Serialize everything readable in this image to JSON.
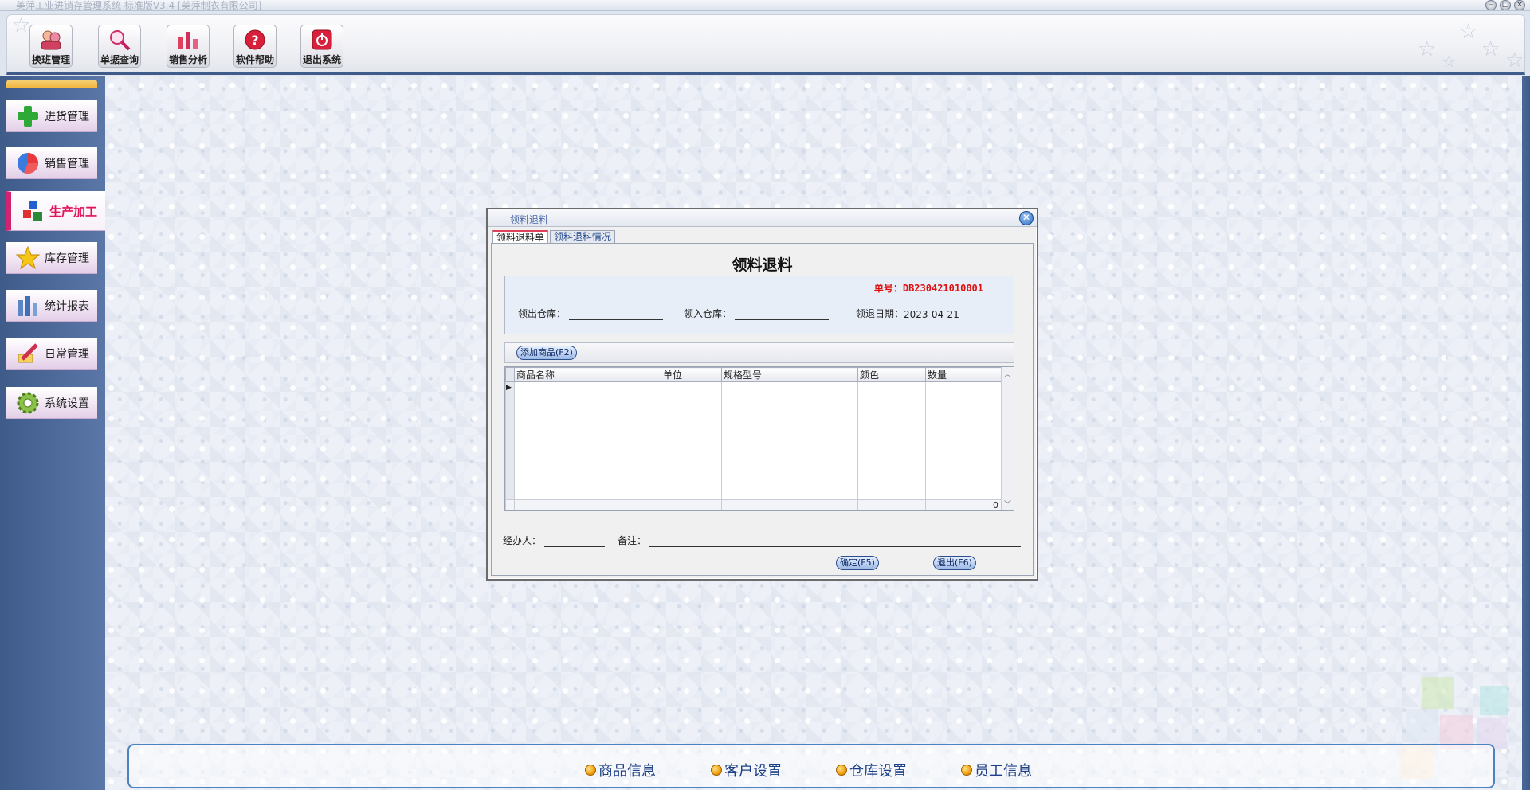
{
  "window": {
    "title": "美萍工业进销存管理系统 标准版V3.4 [美萍制衣有限公司]",
    "controls": [
      "minimize",
      "maximize",
      "close"
    ]
  },
  "toolbar": {
    "buttons": [
      {
        "label": "换班管理",
        "icon": "shift-icon"
      },
      {
        "label": "单据查询",
        "icon": "magnifier-icon"
      },
      {
        "label": "销售分析",
        "icon": "bar-chart-icon"
      },
      {
        "label": "软件帮助",
        "icon": "help-icon"
      },
      {
        "label": "退出系统",
        "icon": "power-icon"
      }
    ]
  },
  "sidebar": {
    "items": [
      {
        "label": "进货管理",
        "icon": "plus-icon",
        "active": false
      },
      {
        "label": "销售管理",
        "icon": "pie-icon",
        "active": false
      },
      {
        "label": "生产加工",
        "icon": "cubes-icon",
        "active": true
      },
      {
        "label": "库存管理",
        "icon": "star-icon",
        "active": false
      },
      {
        "label": "统计报表",
        "icon": "report-icon",
        "active": false
      },
      {
        "label": "日常管理",
        "icon": "pencil-icon",
        "active": false
      },
      {
        "label": "系统设置",
        "icon": "gear-icon",
        "active": false
      }
    ]
  },
  "quickbar": {
    "items": [
      "商品信息",
      "客户设置",
      "仓库设置",
      "员工信息"
    ]
  },
  "dialog": {
    "title": "领料退料",
    "close_symbol": "✕",
    "tabs": [
      "领料退料单",
      "领料退料情况"
    ],
    "form_title": "领料退料",
    "order_no": "单号：DB230421010001",
    "out_warehouse_label": "领出仓库：",
    "out_warehouse_value": "",
    "in_warehouse_label": "领入仓库：",
    "in_warehouse_value": "",
    "date_label": "领退日期：",
    "date_value": "2023-04-21",
    "add_button": "添加商品(F2)",
    "grid": {
      "columns": [
        "商品名称",
        "单位",
        "规格型号",
        "颜色",
        "数量"
      ],
      "rows": [],
      "total_qty": "0"
    },
    "handler_label": "经办人：",
    "handler_value": "",
    "remark_label": "备注：",
    "remark_value": "",
    "confirm_button": "确定(F5)",
    "exit_button": "退出(F6)"
  },
  "colors": {
    "frame_blue": "#3e5b8a",
    "active_accent": "#e0145a",
    "order_red": "#e01010",
    "link_blue": "#1c3f85"
  }
}
